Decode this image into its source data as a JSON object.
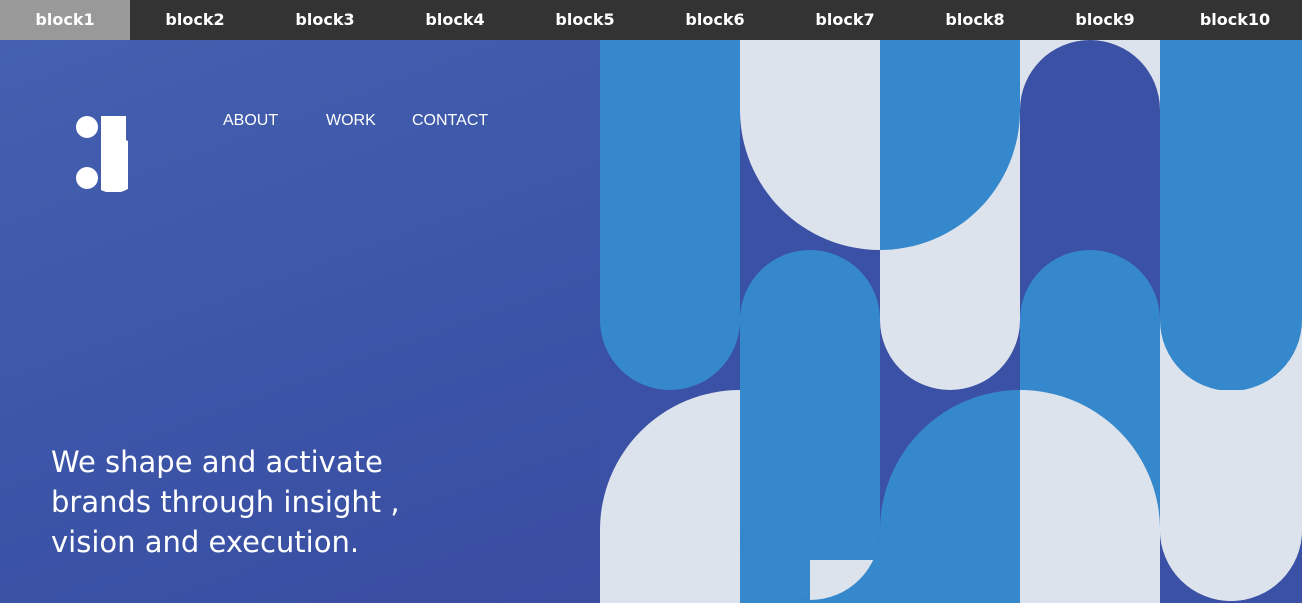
{
  "tabs": [
    {
      "label": "block1",
      "active": true
    },
    {
      "label": "block2"
    },
    {
      "label": "block3"
    },
    {
      "label": "block4"
    },
    {
      "label": "block5"
    },
    {
      "label": "block6"
    },
    {
      "label": "block7"
    },
    {
      "label": "block8"
    },
    {
      "label": "block9"
    },
    {
      "label": "block10"
    }
  ],
  "nav": {
    "about": "ABOUT",
    "work": "WORK",
    "contact": "CONTACT"
  },
  "hero": {
    "line1": "We shape and activate",
    "line2": "brands through insight ,",
    "line3": "vision and execution."
  },
  "colors": {
    "topbar": "#333333",
    "active_tab": "#999999",
    "hero_bg": "#3b53a6",
    "pattern_blue": "#3688cc",
    "pattern_navy": "#3a51a5",
    "pattern_light": "#dde3ec"
  }
}
